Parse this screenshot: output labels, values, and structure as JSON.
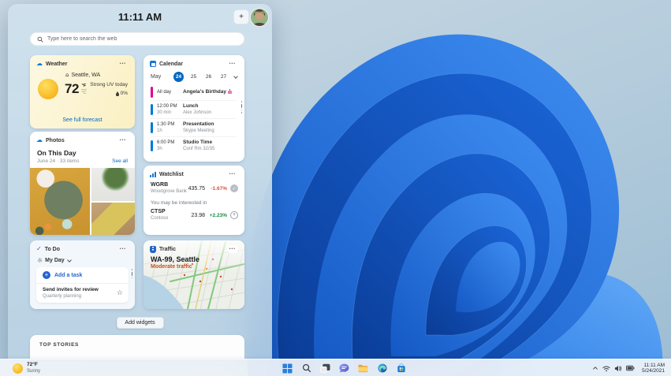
{
  "panel": {
    "time": "11:11 AM",
    "plus_label": "+",
    "search_placeholder": "Type here to search the web",
    "weather": {
      "title": "Weather",
      "location": "Seattle, WA",
      "temp": "72",
      "unit_primary": "°F",
      "unit_secondary": "°C",
      "condition": "Strong UV today",
      "precipitation": "0%",
      "link": "See full forecast"
    },
    "calendar": {
      "title": "Calendar",
      "month": "May",
      "dates": [
        "24",
        "25",
        "26",
        "27"
      ],
      "selected_date": "24",
      "events": [
        {
          "time": "All day",
          "duration": "",
          "title": "Angela's Birthday",
          "title_emoji": "cake",
          "subtitle": "",
          "bar_color": "#e3008c"
        },
        {
          "time": "12:00 PM",
          "duration": "30 min",
          "title": "Lunch",
          "subtitle": "Alex Johnson",
          "bar_color": "#0078d4"
        },
        {
          "time": "1:30 PM",
          "duration": "1h",
          "title": "Presentation",
          "subtitle": "Skype Meeting",
          "bar_color": "#0078d4"
        },
        {
          "time": "6:00 PM",
          "duration": "3h",
          "title": "Studio Time",
          "subtitle": "Conf Rm 32/35",
          "bar_color": "#0078d4"
        }
      ]
    },
    "photos": {
      "title": "Photos",
      "heading": "On This Day",
      "subtitle": "June 24 · 33 items",
      "link": "See all"
    },
    "watchlist": {
      "title": "Watchlist",
      "stocks": [
        {
          "symbol": "WGRB",
          "name": "Woodgrove Bank",
          "price": "435.75",
          "change": "-1.67%",
          "direction": "down"
        },
        {
          "symbol": "CTSP",
          "name": "Contoso",
          "price": "23.98",
          "change": "+2.23%",
          "direction": "up"
        }
      ],
      "suggestion_label": "You may be interested in"
    },
    "todo": {
      "title": "To Do",
      "list_name": "My Day",
      "add_task_label": "Add a task",
      "tasks": [
        {
          "title": "Send invites for review",
          "subtitle": "Quarterly planning"
        }
      ]
    },
    "traffic": {
      "title": "Traffic",
      "heading": "WA-99, Seattle",
      "status": "Moderate traffic"
    },
    "add_widgets_label": "Add widgets",
    "top_stories_label": "TOP STORIES"
  },
  "taskbar": {
    "weather_temp": "72°F",
    "weather_condition": "Sunny",
    "icons": [
      "start",
      "search",
      "task-view",
      "chat",
      "file-explorer",
      "edge",
      "store"
    ],
    "tray_icons": [
      "chevron-up",
      "wifi",
      "volume",
      "battery"
    ],
    "tray_time": "11:11 AM",
    "tray_date": "5/24/2021"
  },
  "colors": {
    "accent": "#0067c0",
    "stock_down": "#d9543a",
    "stock_up": "#178a46",
    "traffic_status": "#c75018",
    "calendar_pink": "#e3008c",
    "calendar_blue": "#0078d4"
  },
  "icons_glyphs": {
    "ellipsis": "•••",
    "home": "⌂",
    "cloud": "☁",
    "sun": "☼",
    "star": "☆",
    "plus": "+",
    "check": "✓",
    "dot_separator": "·"
  }
}
